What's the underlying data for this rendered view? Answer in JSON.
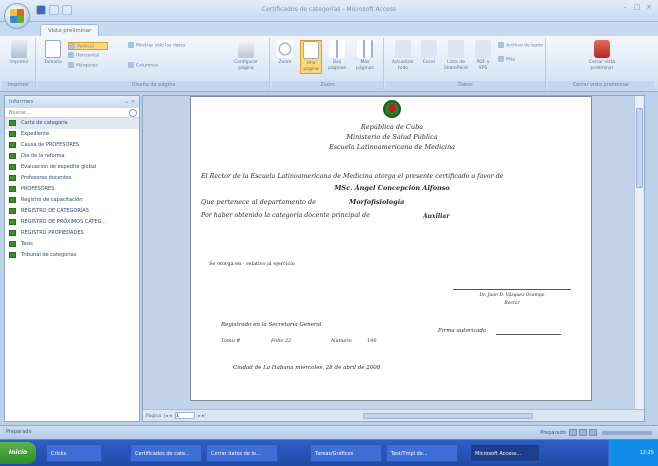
{
  "window": {
    "title": "Certificados de categorías - Microsoft Access"
  },
  "tabs": [
    "Vista preliminar"
  ],
  "ribbon": {
    "groups": [
      {
        "label": "Imprimir",
        "buttons": [
          "Imprimir"
        ]
      },
      {
        "label": "Diseño de página",
        "buttons": [
          "Tamaño",
          "Vertical",
          "Horizontal",
          "Márgenes",
          "Mostrar sólo los datos",
          "Columnas",
          "Configurar página"
        ]
      },
      {
        "label": "Zoom",
        "buttons": [
          "Zoom",
          "Una página",
          "Dos páginas",
          "Más páginas"
        ]
      },
      {
        "label": "Datos",
        "buttons": [
          "Actualizar todo",
          "Excel",
          "Lista de SharePoint",
          "PDF o XPS",
          "Archivo de texto",
          "Más"
        ]
      },
      {
        "label": "Cerrar vista preliminar",
        "buttons": [
          "Cerrar vista preliminar"
        ]
      }
    ]
  },
  "nav": {
    "header": "Informes",
    "search": "Buscar...",
    "items": [
      "Carta de categoría",
      "Expediente",
      "Causa de PROFESORES",
      "Día de la reforma",
      "Evaluación de expedite global",
      "Profesores docentes",
      "PROFESORES",
      "Registro de capacitación",
      "REGISTRO DE CATEGORÍAS",
      "REGISTRO DE PRÓXIMOS CATEG...",
      "REGISTRO PROPIEDADES",
      "Tesis",
      "Tribunal de categorías"
    ],
    "active_index": 0
  },
  "certificate": {
    "line1": "República de Cuba",
    "line2": "Ministerio de Salud Pública",
    "line3": "Escuela Latinoamericana de Medicina",
    "body1": "El Rector de la Escuela Latinoamericana de Medicina otorga el presente certificado a favor de",
    "recipient": "MSc. Ángel Concepción Alfonso",
    "body2_prefix": "Que pertenece al departamento de",
    "department": "Morfofisiología",
    "body3_prefix": "Por haber obtenido la categoría docente principal de",
    "category": "Auxiliar",
    "resolution": "Se otorga en   ·   relativo al ejercicio",
    "signatory_name": "Dr. Juan D. Vázquez Ocampo",
    "signatory_title": "Rector",
    "registry": "Registrado en la Secretaría General",
    "tomo_label": "Tomo #",
    "folio_label": "Folio 22",
    "numero_label": "Número",
    "numero_value": "190",
    "firma": "Firma autorizada",
    "place_date": "Ciudad de La Habana     miércoles, 28 de abril de 2008"
  },
  "pager": {
    "label": "Página:",
    "value": "1"
  },
  "status": {
    "left": "Preparado",
    "right": "Preparado"
  },
  "taskbar": {
    "start": "Inicio",
    "items": [
      "Cricks",
      "Certificados de cate...",
      "Cerrar datos de le...",
      "Tareas/Gráficos",
      "Test/Tmpl de...",
      "Microsoft Access..."
    ],
    "clock": "12:25"
  }
}
